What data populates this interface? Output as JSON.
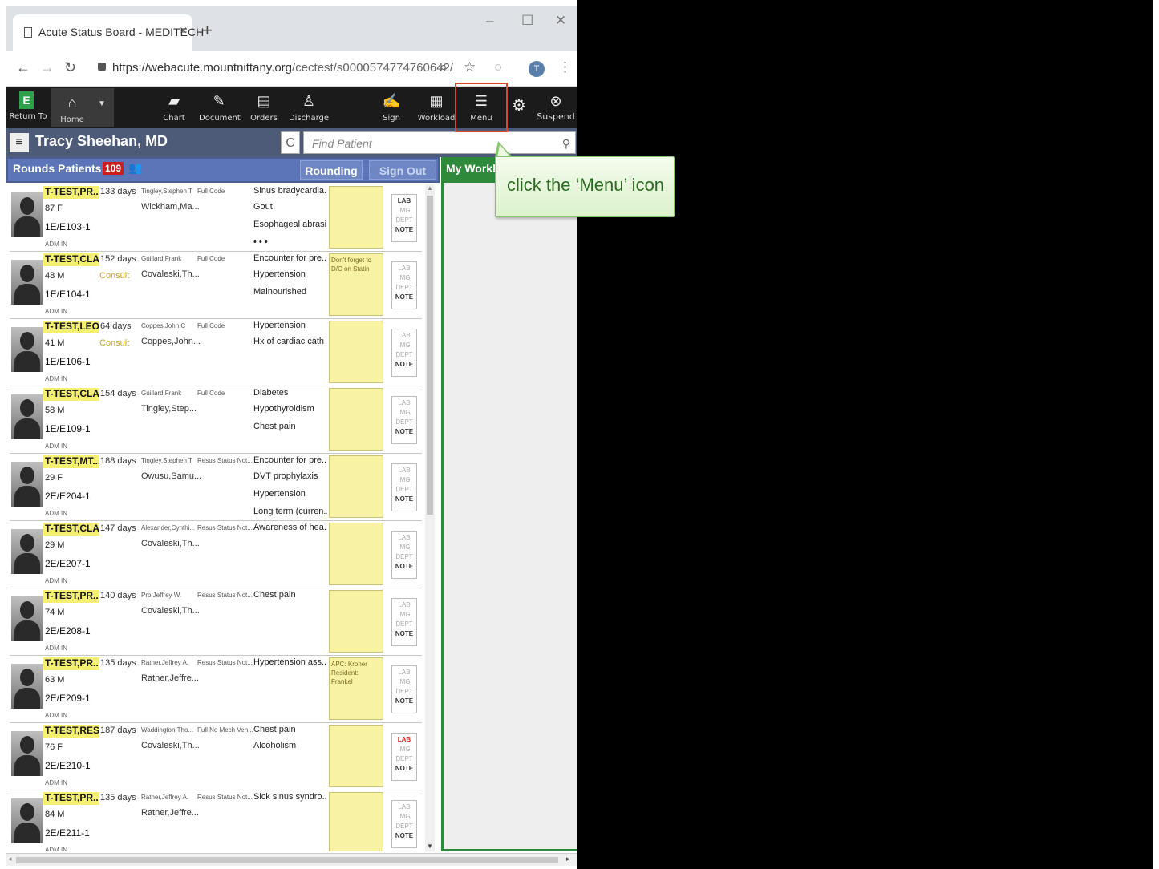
{
  "browser": {
    "tab_title": "Acute Status Board - MEDITECH",
    "tab_close": "×",
    "new_tab": "+",
    "minimize": "–",
    "maximize": "☐",
    "close": "✕",
    "url_host": "https://webacute.mountnittany.org",
    "url_path": "/cectest/s0000574774760642/",
    "avatar_letter": "T"
  },
  "toolbar": {
    "return_to": "Return To",
    "home": "Home",
    "chart": "Chart",
    "document": "Document",
    "orders": "Orders",
    "discharge": "Discharge",
    "sign": "Sign",
    "workload": "Workload",
    "menu": "Menu",
    "suspend": "Suspend",
    "e_logo": "E"
  },
  "titlebar": {
    "user_name": "Tracy Sheehan, MD",
    "find_placeholder": "Find Patient"
  },
  "panel": {
    "title": "Rounds Patients",
    "count": "109",
    "rounding_button": "Rounding",
    "sign_out_button": "Sign Out",
    "worklist_title": "My Worklis"
  },
  "patients": [
    {
      "name": "T-TEST,PR...",
      "days": "133 days",
      "agesex": "87 F",
      "consult": "",
      "room": "1E/E103-1",
      "adm": "ADM IN",
      "doc1": "Tingley,Stephen T",
      "code": "Full Code",
      "doc2": "Wickham,Ma...",
      "dx": [
        "Sinus bradycardia...",
        "Gout",
        "Esophageal abrasi...",
        "• • •"
      ],
      "note": "",
      "flags": [
        "LAB",
        "IMG",
        "DEPT",
        "NOTE"
      ]
    },
    {
      "name": "T-TEST,CLA...",
      "days": "152 days",
      "agesex": "48 M",
      "consult": "Consult",
      "room": "1E/E104-1",
      "adm": "ADM IN",
      "doc1": "Guillard,Frank",
      "code": "Full Code",
      "doc2": "Covaleski,Th...",
      "dx": [
        "Encounter for pre...",
        "Hypertension",
        "Malnourished"
      ],
      "note": "Don't forget to D/C on Statin",
      "flags": [
        "LAB",
        "IMG",
        "DEPT",
        "NOTE"
      ]
    },
    {
      "name": "T-TEST,LEO...",
      "days": "64 days",
      "agesex": "41 M",
      "consult": "Consult",
      "room": "1E/E106-1",
      "adm": "ADM IN",
      "doc1": "Coppes,John C",
      "code": "Full Code",
      "doc2": "Coppes,John...",
      "dx": [
        "Hypertension",
        "Hx of cardiac cath"
      ],
      "note": "",
      "flags": [
        "LAB",
        "IMG",
        "DEPT",
        "NOTE"
      ]
    },
    {
      "name": "T-TEST,CLA...",
      "days": "154 days",
      "agesex": "58 M",
      "consult": "",
      "room": "1E/E109-1",
      "adm": "ADM IN",
      "doc1": "Guillard,Frank",
      "code": "Full Code",
      "doc2": "Tingley,Step...",
      "dx": [
        "Diabetes",
        "Hypothyroidism",
        "Chest pain"
      ],
      "note": "",
      "flags": [
        "LAB",
        "IMG",
        "DEPT",
        "NOTE"
      ]
    },
    {
      "name": "T-TEST,MT...",
      "days": "188 days",
      "agesex": "29 F",
      "consult": "",
      "room": "2E/E204-1",
      "adm": "ADM IN",
      "doc1": "Tingley,Stephen T",
      "code": "Resus Status Not...",
      "doc2": "Owusu,Samu...",
      "dx": [
        "Encounter for pre...",
        "DVT prophylaxis",
        "Hypertension",
        "Long term (curren..."
      ],
      "note": "",
      "flags": [
        "LAB",
        "IMG",
        "DEPT",
        "NOTE"
      ]
    },
    {
      "name": "T-TEST,CLA...",
      "days": "147 days",
      "agesex": "29 M",
      "consult": "",
      "room": "2E/E207-1",
      "adm": "ADM IN",
      "doc1": "Alexander,Cynthi...",
      "code": "Resus Status Not...",
      "doc2": "Covaleski,Th...",
      "dx": [
        "Awareness of hea..."
      ],
      "note": "",
      "flags": [
        "LAB",
        "IMG",
        "DEPT",
        "NOTE"
      ]
    },
    {
      "name": "T-TEST,PR...",
      "days": "140 days",
      "agesex": "74 M",
      "consult": "",
      "room": "2E/E208-1",
      "adm": "ADM IN",
      "doc1": "Pro,Jeffrey W.",
      "code": "Resus Status Not...",
      "doc2": "Covaleski,Th...",
      "dx": [
        "Chest pain"
      ],
      "note": "",
      "flags": [
        "LAB",
        "IMG",
        "DEPT",
        "NOTE"
      ]
    },
    {
      "name": "T-TEST,PR...",
      "days": "135 days",
      "agesex": "63 M",
      "consult": "",
      "room": "2E/E209-1",
      "adm": "ADM IN",
      "doc1": "Ratner,Jeffrey A.",
      "code": "Resus Status Not...",
      "doc2": "Ratner,Jeffre...",
      "dx": [
        "Hypertension ass..."
      ],
      "note": "APC: Kroner Resident: Frankel",
      "flags": [
        "LAB",
        "IMG",
        "DEPT",
        "NOTE"
      ]
    },
    {
      "name": "T-TEST,RES...",
      "days": "187 days",
      "agesex": "76 F",
      "consult": "",
      "room": "2E/E210-1",
      "adm": "ADM IN",
      "doc1": "Waddington,Tho...",
      "code": "Full No Mech Ven...",
      "doc2": "Covaleski,Th...",
      "dx": [
        "Chest pain",
        "Alcoholism"
      ],
      "note": "",
      "flags": [
        "LAB",
        "IMG",
        "DEPT",
        "NOTE"
      ]
    },
    {
      "name": "T-TEST,PR...",
      "days": "135 days",
      "agesex": "84 M",
      "consult": "",
      "room": "2E/E211-1",
      "adm": "ADM IN",
      "doc1": "Ratner,Jeffrey A.",
      "code": "Resus Status Not...",
      "doc2": "Ratner,Jeffre...",
      "dx": [
        "Sick sinus syndro..."
      ],
      "note": "",
      "flags": [
        "LAB",
        "IMG",
        "DEPT",
        "NOTE"
      ]
    }
  ],
  "tooltip": {
    "text": "click the ‘Menu’ icon"
  },
  "colors": {
    "toolbar_bg": "#1b1b1b",
    "titlebar_bg": "#4d5a78",
    "panel_header_bg": "#5b75b8",
    "worklist_green": "#2e8a3a",
    "highlight_red": "#d9482c",
    "note_yellow": "#f7f3a3",
    "name_yellow": "#f5f071",
    "tooltip_green": "#86c66b"
  },
  "icons": {
    "return_to": "e-logo",
    "home": "house-icon",
    "chart": "folder-icon",
    "document": "pencil-icon",
    "orders": "clipboard-icon",
    "discharge": "person-icon",
    "sign": "signature-icon",
    "workload": "calendar-icon",
    "menu": "list-icon",
    "settings": "gear-icon",
    "suspend": "close-circle-icon"
  }
}
